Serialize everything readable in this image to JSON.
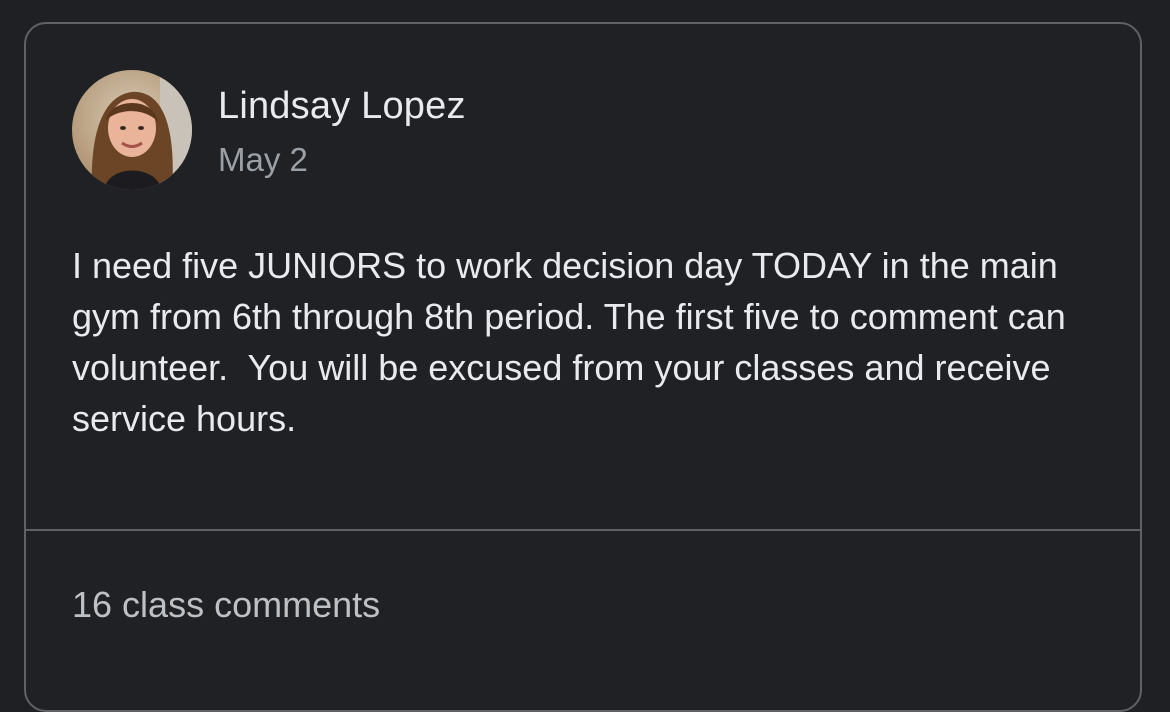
{
  "post": {
    "author_name": "Lindsay Lopez",
    "date": "May 2",
    "body": "I need five JUNIORS to work decision day TODAY in the main gym from 6th through 8th period. The first five to comment can volunteer.  You will be excused from your classes and receive service hours.",
    "comments_label": "16 class comments"
  },
  "colors": {
    "background": "#1f2023",
    "card_border": "#5f6166",
    "primary_text": "#e8eaed",
    "secondary_text": "#9aa0a6"
  }
}
